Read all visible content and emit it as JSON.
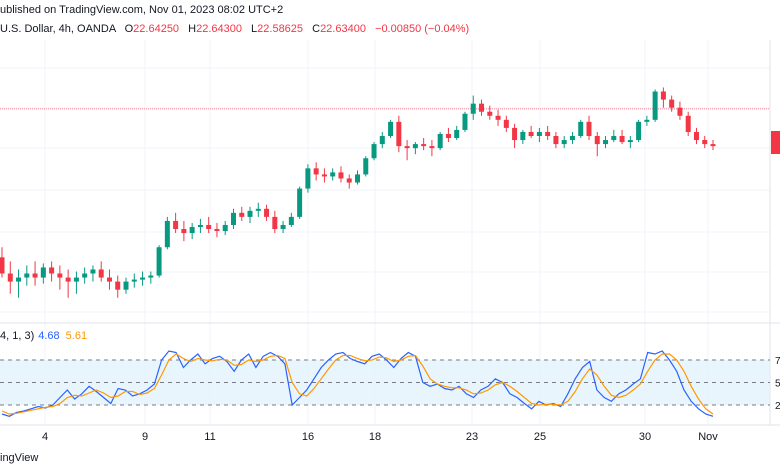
{
  "header": {
    "published": "ublished on TradingView.com, Nov 01, 2023 08:02 UTC+2"
  },
  "legend": {
    "symbol": "U.S. Dollar, 4h, OANDA",
    "o_label": "O",
    "o": "22.64250",
    "h_label": "H",
    "h": "22.64300",
    "l_label": "L",
    "l": "22.58625",
    "c_label": "C",
    "c": "22.63400",
    "change": "−0.00850 (−0.04%)"
  },
  "stoch_legend": {
    "params": "4, 1, 3)",
    "k": "4.68",
    "d": "5.61"
  },
  "footer": {
    "brand": "ingView"
  },
  "x_axis": [
    "4",
    "9",
    "11",
    "16",
    "18",
    "23",
    "25",
    "30",
    "Nov"
  ],
  "stoch_axis": [
    "7",
    "5",
    "2"
  ],
  "colors": {
    "up": "#089981",
    "down": "#f23645",
    "k": "#2962ff",
    "d": "#ff9800",
    "band": "#e3f2fd"
  },
  "chart_data": [
    {
      "type": "candlestick",
      "note_units": "price",
      "ylim": [
        21.6,
        22.95
      ],
      "last_price": 22.634,
      "candles": [
        [
          21.9,
          21.95,
          21.8,
          21.82
        ],
        [
          21.82,
          21.88,
          21.72,
          21.78
        ],
        [
          21.78,
          21.84,
          21.7,
          21.8
        ],
        [
          21.8,
          21.86,
          21.76,
          21.82
        ],
        [
          21.82,
          21.88,
          21.76,
          21.8
        ],
        [
          21.8,
          21.87,
          21.77,
          21.85
        ],
        [
          21.85,
          21.88,
          21.78,
          21.82
        ],
        [
          21.82,
          21.86,
          21.74,
          21.8
        ],
        [
          21.8,
          21.84,
          21.7,
          21.78
        ],
        [
          21.78,
          21.83,
          21.72,
          21.8
        ],
        [
          21.8,
          21.85,
          21.77,
          21.82
        ],
        [
          21.82,
          21.86,
          21.78,
          21.84
        ],
        [
          21.84,
          21.88,
          21.78,
          21.8
        ],
        [
          21.8,
          21.84,
          21.74,
          21.78
        ],
        [
          21.78,
          21.81,
          21.7,
          21.74
        ],
        [
          21.74,
          21.8,
          21.72,
          21.78
        ],
        [
          21.78,
          21.82,
          21.75,
          21.79
        ],
        [
          21.79,
          21.83,
          21.76,
          21.8
        ],
        [
          21.8,
          21.83,
          21.77,
          21.81
        ],
        [
          21.81,
          21.96,
          21.8,
          21.95
        ],
        [
          21.95,
          22.1,
          21.94,
          22.08
        ],
        [
          22.08,
          22.12,
          22.02,
          22.04
        ],
        [
          22.04,
          22.08,
          21.98,
          22.02
        ],
        [
          22.02,
          22.07,
          21.99,
          22.05
        ],
        [
          22.05,
          22.09,
          22.02,
          22.06
        ],
        [
          22.06,
          22.1,
          22.02,
          22.04
        ],
        [
          22.04,
          22.07,
          22.0,
          22.03
        ],
        [
          22.03,
          22.08,
          22.01,
          22.06
        ],
        [
          22.06,
          22.14,
          22.04,
          22.12
        ],
        [
          22.12,
          22.15,
          22.08,
          22.1
        ],
        [
          22.1,
          22.15,
          22.07,
          22.13
        ],
        [
          22.13,
          22.17,
          22.1,
          22.14
        ],
        [
          22.14,
          22.16,
          22.08,
          22.1
        ],
        [
          22.1,
          22.13,
          22.02,
          22.04
        ],
        [
          22.04,
          22.08,
          22.02,
          22.06
        ],
        [
          22.06,
          22.12,
          22.05,
          22.1
        ],
        [
          22.1,
          22.25,
          22.09,
          22.24
        ],
        [
          22.24,
          22.36,
          22.22,
          22.34
        ],
        [
          22.34,
          22.37,
          22.28,
          22.31
        ],
        [
          22.31,
          22.34,
          22.27,
          22.3
        ],
        [
          22.3,
          22.34,
          22.28,
          22.32
        ],
        [
          22.32,
          22.35,
          22.27,
          22.29
        ],
        [
          22.29,
          22.31,
          22.24,
          22.27
        ],
        [
          22.27,
          22.33,
          22.26,
          22.31
        ],
        [
          22.31,
          22.4,
          22.3,
          22.39
        ],
        [
          22.39,
          22.47,
          22.38,
          22.46
        ],
        [
          22.46,
          22.52,
          22.44,
          22.5
        ],
        [
          22.5,
          22.58,
          22.49,
          22.57
        ],
        [
          22.57,
          22.6,
          22.42,
          22.45
        ],
        [
          22.45,
          22.48,
          22.38,
          22.44
        ],
        [
          22.44,
          22.47,
          22.41,
          22.46
        ],
        [
          22.46,
          22.49,
          22.43,
          22.45
        ],
        [
          22.45,
          22.48,
          22.4,
          22.44
        ],
        [
          22.44,
          22.52,
          22.43,
          22.51
        ],
        [
          22.51,
          22.54,
          22.47,
          22.49
        ],
        [
          22.49,
          22.55,
          22.48,
          22.53
        ],
        [
          22.53,
          22.62,
          22.52,
          22.61
        ],
        [
          22.61,
          22.7,
          22.58,
          22.66
        ],
        [
          22.66,
          22.68,
          22.6,
          22.62
        ],
        [
          22.62,
          22.65,
          22.58,
          22.6
        ],
        [
          22.6,
          22.63,
          22.55,
          22.58
        ],
        [
          22.58,
          22.6,
          22.52,
          22.54
        ],
        [
          22.54,
          22.56,
          22.44,
          22.48
        ],
        [
          22.48,
          22.53,
          22.46,
          22.52
        ],
        [
          22.52,
          22.55,
          22.49,
          22.5
        ],
        [
          22.5,
          22.54,
          22.47,
          22.52
        ],
        [
          22.52,
          22.55,
          22.48,
          22.5
        ],
        [
          22.5,
          22.52,
          22.44,
          22.46
        ],
        [
          22.46,
          22.5,
          22.44,
          22.48
        ],
        [
          22.48,
          22.52,
          22.46,
          22.5
        ],
        [
          22.5,
          22.58,
          22.49,
          22.57
        ],
        [
          22.57,
          22.6,
          22.48,
          22.5
        ],
        [
          22.5,
          22.52,
          22.4,
          22.46
        ],
        [
          22.46,
          22.5,
          22.44,
          22.48
        ],
        [
          22.48,
          22.53,
          22.47,
          22.5
        ],
        [
          22.5,
          22.53,
          22.46,
          22.47
        ],
        [
          22.47,
          22.5,
          22.44,
          22.48
        ],
        [
          22.48,
          22.58,
          22.47,
          22.57
        ],
        [
          22.57,
          22.6,
          22.55,
          22.58
        ],
        [
          22.58,
          22.73,
          22.57,
          22.72
        ],
        [
          22.72,
          22.74,
          22.64,
          22.68
        ],
        [
          22.68,
          22.7,
          22.62,
          22.64
        ],
        [
          22.64,
          22.67,
          22.58,
          22.6
        ],
        [
          22.6,
          22.62,
          22.5,
          22.52
        ],
        [
          22.52,
          22.54,
          22.46,
          22.48
        ],
        [
          22.48,
          22.5,
          22.44,
          22.46
        ],
        [
          22.46,
          22.48,
          22.43,
          22.45
        ]
      ]
    },
    {
      "type": "line",
      "title": "",
      "ylim": [
        0,
        100
      ],
      "bands": [
        20,
        50,
        80
      ],
      "series": [
        {
          "name": "K",
          "values": [
            8,
            5,
            10,
            12,
            15,
            18,
            16,
            20,
            30,
            40,
            28,
            35,
            45,
            38,
            30,
            22,
            42,
            40,
            32,
            35,
            40,
            48,
            80,
            92,
            90,
            70,
            80,
            88,
            75,
            82,
            85,
            78,
            65,
            80,
            88,
            70,
            85,
            90,
            85,
            75,
            20,
            30,
            40,
            55,
            70,
            80,
            88,
            90,
            82,
            78,
            75,
            85,
            88,
            80,
            70,
            82,
            90,
            85,
            50,
            45,
            48,
            42,
            40,
            45,
            35,
            30,
            40,
            45,
            55,
            50,
            35,
            30,
            22,
            15,
            25,
            20,
            22,
            18,
            35,
            55,
            70,
            78,
            40,
            30,
            25,
            35,
            40,
            48,
            55,
            90,
            88,
            92,
            80,
            65,
            40,
            25,
            15,
            8,
            5
          ]
        },
        {
          "name": "D",
          "values": [
            12,
            8,
            9,
            11,
            13,
            15,
            17,
            18,
            22,
            30,
            33,
            32,
            36,
            40,
            36,
            30,
            32,
            38,
            38,
            34,
            36,
            42,
            60,
            80,
            88,
            82,
            78,
            82,
            80,
            79,
            81,
            80,
            73,
            74,
            80,
            78,
            80,
            85,
            86,
            82,
            50,
            35,
            32,
            42,
            55,
            68,
            80,
            86,
            86,
            82,
            79,
            80,
            84,
            83,
            78,
            80,
            85,
            86,
            72,
            55,
            48,
            45,
            43,
            43,
            40,
            35,
            36,
            40,
            47,
            50,
            45,
            38,
            30,
            22,
            20,
            21,
            21,
            20,
            25,
            38,
            55,
            68,
            60,
            45,
            33,
            30,
            33,
            40,
            48,
            65,
            80,
            88,
            88,
            80,
            65,
            45,
            28,
            15,
            8
          ]
        }
      ]
    }
  ]
}
